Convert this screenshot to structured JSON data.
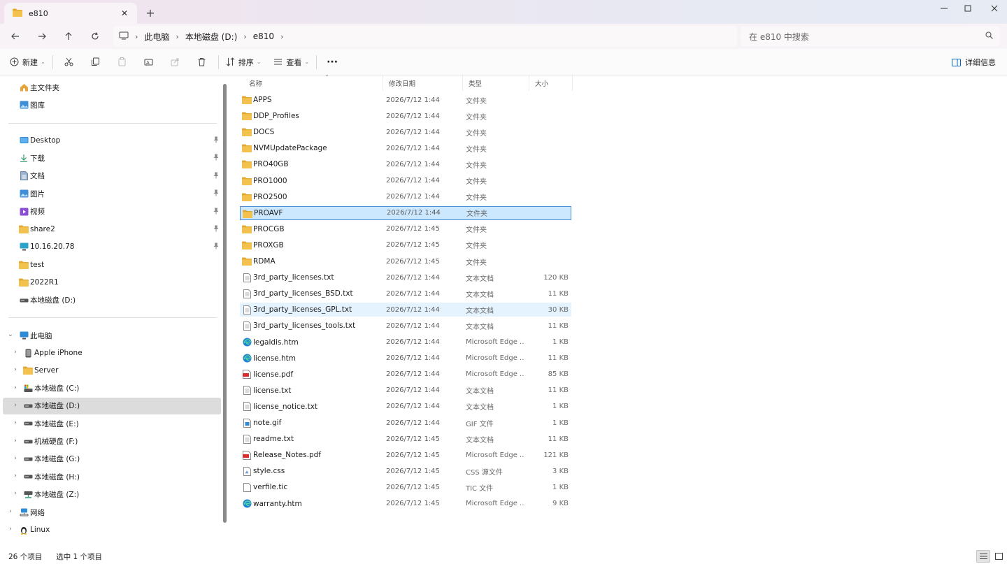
{
  "window": {
    "tab_title": "e810",
    "tab_close": "✕",
    "new_tab": "+"
  },
  "address": {
    "crumbs": [
      "此电脑",
      "本地磁盘 (D:)",
      "e810"
    ],
    "search_placeholder": "在 e810 中搜索"
  },
  "toolbar": {
    "new_label": "新建",
    "sort_label": "排序",
    "view_label": "查看",
    "more_label": "···",
    "details_label": "详细信息"
  },
  "nav": {
    "home": "主文件夹",
    "gallery": "图库",
    "quick": [
      {
        "label": "Desktop",
        "icon": "desktop-icon"
      },
      {
        "label": "下载",
        "icon": "download-icon"
      },
      {
        "label": "文档",
        "icon": "document-icon"
      },
      {
        "label": "图片",
        "icon": "pictures-icon"
      },
      {
        "label": "视频",
        "icon": "videos-icon"
      },
      {
        "label": "share2",
        "icon": "folder-icon"
      },
      {
        "label": "10.16.20.78",
        "icon": "network-pc-icon"
      },
      {
        "label": "test",
        "icon": "folder-icon"
      },
      {
        "label": "2022R1",
        "icon": "folder-icon"
      },
      {
        "label": "本地磁盘 (D:)",
        "icon": "drive-icon"
      }
    ],
    "this_pc": "此电脑",
    "pc_children": [
      {
        "label": "Apple iPhone",
        "icon": "phone-icon"
      },
      {
        "label": "Server",
        "icon": "folder-icon"
      },
      {
        "label": "本地磁盘 (C:)",
        "icon": "system-drive-icon"
      },
      {
        "label": "本地磁盘 (D:)",
        "icon": "drive-icon"
      },
      {
        "label": "本地磁盘 (E:)",
        "icon": "drive-icon"
      },
      {
        "label": "机械硬盘 (F:)",
        "icon": "drive-icon"
      },
      {
        "label": "本地磁盘 (G:)",
        "icon": "drive-icon"
      },
      {
        "label": "本地磁盘 (H:)",
        "icon": "drive-icon"
      },
      {
        "label": "本地磁盘 (Z:)",
        "icon": "network-drive-icon"
      }
    ],
    "network": "网络",
    "linux": "Linux"
  },
  "columns": {
    "name": "名称",
    "date": "修改日期",
    "type": "类型",
    "size": "大小"
  },
  "files": [
    {
      "name": "APPS",
      "date": "2026/7/12 1:44",
      "type": "文件夹",
      "size": "",
      "kind": "folder"
    },
    {
      "name": "DDP_Profiles",
      "date": "2026/7/12 1:44",
      "type": "文件夹",
      "size": "",
      "kind": "folder"
    },
    {
      "name": "DOCS",
      "date": "2026/7/12 1:44",
      "type": "文件夹",
      "size": "",
      "kind": "folder"
    },
    {
      "name": "NVMUpdatePackage",
      "date": "2026/7/12 1:44",
      "type": "文件夹",
      "size": "",
      "kind": "folder"
    },
    {
      "name": "PRO40GB",
      "date": "2026/7/12 1:44",
      "type": "文件夹",
      "size": "",
      "kind": "folder"
    },
    {
      "name": "PRO1000",
      "date": "2026/7/12 1:44",
      "type": "文件夹",
      "size": "",
      "kind": "folder"
    },
    {
      "name": "PRO2500",
      "date": "2026/7/12 1:44",
      "type": "文件夹",
      "size": "",
      "kind": "folder"
    },
    {
      "name": "PROAVF",
      "date": "2026/7/12 1:44",
      "type": "文件夹",
      "size": "",
      "kind": "folder",
      "state": "selected"
    },
    {
      "name": "PROCGB",
      "date": "2026/7/12 1:45",
      "type": "文件夹",
      "size": "",
      "kind": "folder"
    },
    {
      "name": "PROXGB",
      "date": "2026/7/12 1:45",
      "type": "文件夹",
      "size": "",
      "kind": "folder"
    },
    {
      "name": "RDMA",
      "date": "2026/7/12 1:45",
      "type": "文件夹",
      "size": "",
      "kind": "folder"
    },
    {
      "name": "3rd_party_licenses.txt",
      "date": "2026/7/12 1:44",
      "type": "文本文档",
      "size": "120 KB",
      "kind": "text"
    },
    {
      "name": "3rd_party_licenses_BSD.txt",
      "date": "2026/7/12 1:44",
      "type": "文本文档",
      "size": "11 KB",
      "kind": "text"
    },
    {
      "name": "3rd_party_licenses_GPL.txt",
      "date": "2026/7/12 1:44",
      "type": "文本文档",
      "size": "30 KB",
      "kind": "text",
      "state": "hover"
    },
    {
      "name": "3rd_party_licenses_tools.txt",
      "date": "2026/7/12 1:44",
      "type": "文本文档",
      "size": "11 KB",
      "kind": "text"
    },
    {
      "name": "legaldis.htm",
      "date": "2026/7/12 1:44",
      "type": "Microsoft Edge ...",
      "size": "1 KB",
      "kind": "edge"
    },
    {
      "name": "license.htm",
      "date": "2026/7/12 1:44",
      "type": "Microsoft Edge ...",
      "size": "11 KB",
      "kind": "edge"
    },
    {
      "name": "license.pdf",
      "date": "2026/7/12 1:44",
      "type": "Microsoft Edge ...",
      "size": "85 KB",
      "kind": "pdf"
    },
    {
      "name": "license.txt",
      "date": "2026/7/12 1:44",
      "type": "文本文档",
      "size": "11 KB",
      "kind": "text"
    },
    {
      "name": "license_notice.txt",
      "date": "2026/7/12 1:44",
      "type": "文本文档",
      "size": "1 KB",
      "kind": "text"
    },
    {
      "name": "note.gif",
      "date": "2026/7/12 1:44",
      "type": "GIF 文件",
      "size": "1 KB",
      "kind": "image"
    },
    {
      "name": "readme.txt",
      "date": "2026/7/12 1:45",
      "type": "文本文档",
      "size": "11 KB",
      "kind": "text"
    },
    {
      "name": "Release_Notes.pdf",
      "date": "2026/7/12 1:45",
      "type": "Microsoft Edge ...",
      "size": "121 KB",
      "kind": "pdf"
    },
    {
      "name": "style.css",
      "date": "2026/7/12 1:45",
      "type": "CSS 源文件",
      "size": "3 KB",
      "kind": "css"
    },
    {
      "name": "verfile.tic",
      "date": "2026/7/12 1:45",
      "type": "TIC 文件",
      "size": "1 KB",
      "kind": "blank"
    },
    {
      "name": "warranty.htm",
      "date": "2026/7/12 1:45",
      "type": "Microsoft Edge ...",
      "size": "9 KB",
      "kind": "edge"
    }
  ],
  "status": {
    "count": "26 个项目",
    "selection": "选中 1 个项目"
  },
  "colors": {
    "folder": "#f2c14e",
    "folder_dark": "#e3a832",
    "selection_bg": "#cce8ff",
    "selection_border": "#4b90d2",
    "hover_bg": "#e5f3ff",
    "accent": "#0067c0"
  }
}
